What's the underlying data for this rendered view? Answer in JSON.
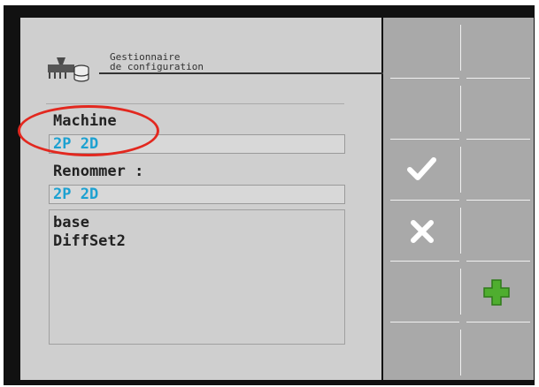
{
  "header": {
    "title_line1": "Gestionnaire",
    "title_line2": "de configuration",
    "icon": "seeder-database-icon"
  },
  "machine": {
    "label": "Machine",
    "value": "2P 2D"
  },
  "rename": {
    "label": "Renommer :",
    "value": "2P 2D"
  },
  "configs": {
    "items": [
      "base",
      "DiffSet2"
    ]
  },
  "softkeys": [
    {
      "name": "empty-softkey-1"
    },
    {
      "name": "empty-softkey-2"
    },
    {
      "name": "confirm-icon"
    },
    {
      "name": "cancel-icon"
    },
    {
      "name": "add-icon"
    },
    {
      "name": "empty-softkey-6"
    }
  ],
  "colors": {
    "accent": "#1da1d1",
    "highlight": "#e2281f",
    "add": "#4fae2f",
    "panel": "#cfcfcf",
    "softkey_bg": "#a9a9a9"
  }
}
